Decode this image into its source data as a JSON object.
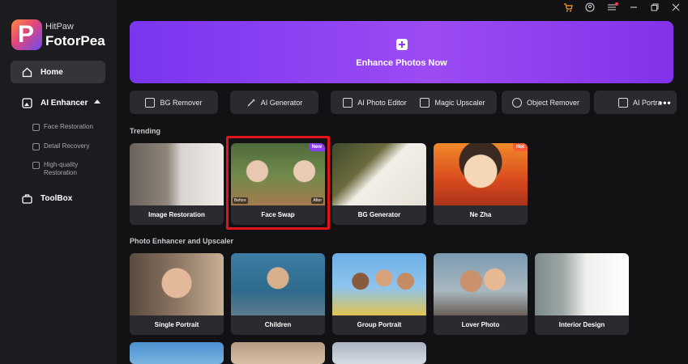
{
  "app": {
    "brand_line1": "HitPaw",
    "brand_line2": "FotorPea",
    "logo_letter": "P"
  },
  "sidebar": {
    "home": "Home",
    "ai_enhancer": "AI Enhancer",
    "sub_items": [
      "Face Restoration",
      "Detail Recovery",
      "High-quality Restoration"
    ],
    "toolbox": "ToolBox"
  },
  "banner": {
    "title": "Enhance Photos Now"
  },
  "tools": [
    "BG Remover",
    "AI Generator",
    "AI Photo Editor",
    "Magic Upscaler",
    "Object Remover",
    "AI Portra"
  ],
  "more_label": "•••",
  "trending": {
    "title": "Trending",
    "cards": [
      {
        "label": "Image Restoration"
      },
      {
        "label": "Face Swap",
        "badge": "New",
        "before": "Before",
        "after": "After"
      },
      {
        "label": "BG Generator"
      },
      {
        "label": "Ne Zha",
        "badge": "Hot"
      }
    ]
  },
  "enhancer": {
    "title": "Photo Enhancer and Upscaler",
    "cards": [
      {
        "label": "Single Portrait"
      },
      {
        "label": "Children"
      },
      {
        "label": "Group Portrait"
      },
      {
        "label": "Lover Photo"
      },
      {
        "label": "Interior Design"
      }
    ]
  },
  "colors": {
    "accent": "#8a3ef0",
    "badge_new": "#8a3ef0",
    "badge_hot": "#ff5a36",
    "selection": "#e0141a"
  }
}
